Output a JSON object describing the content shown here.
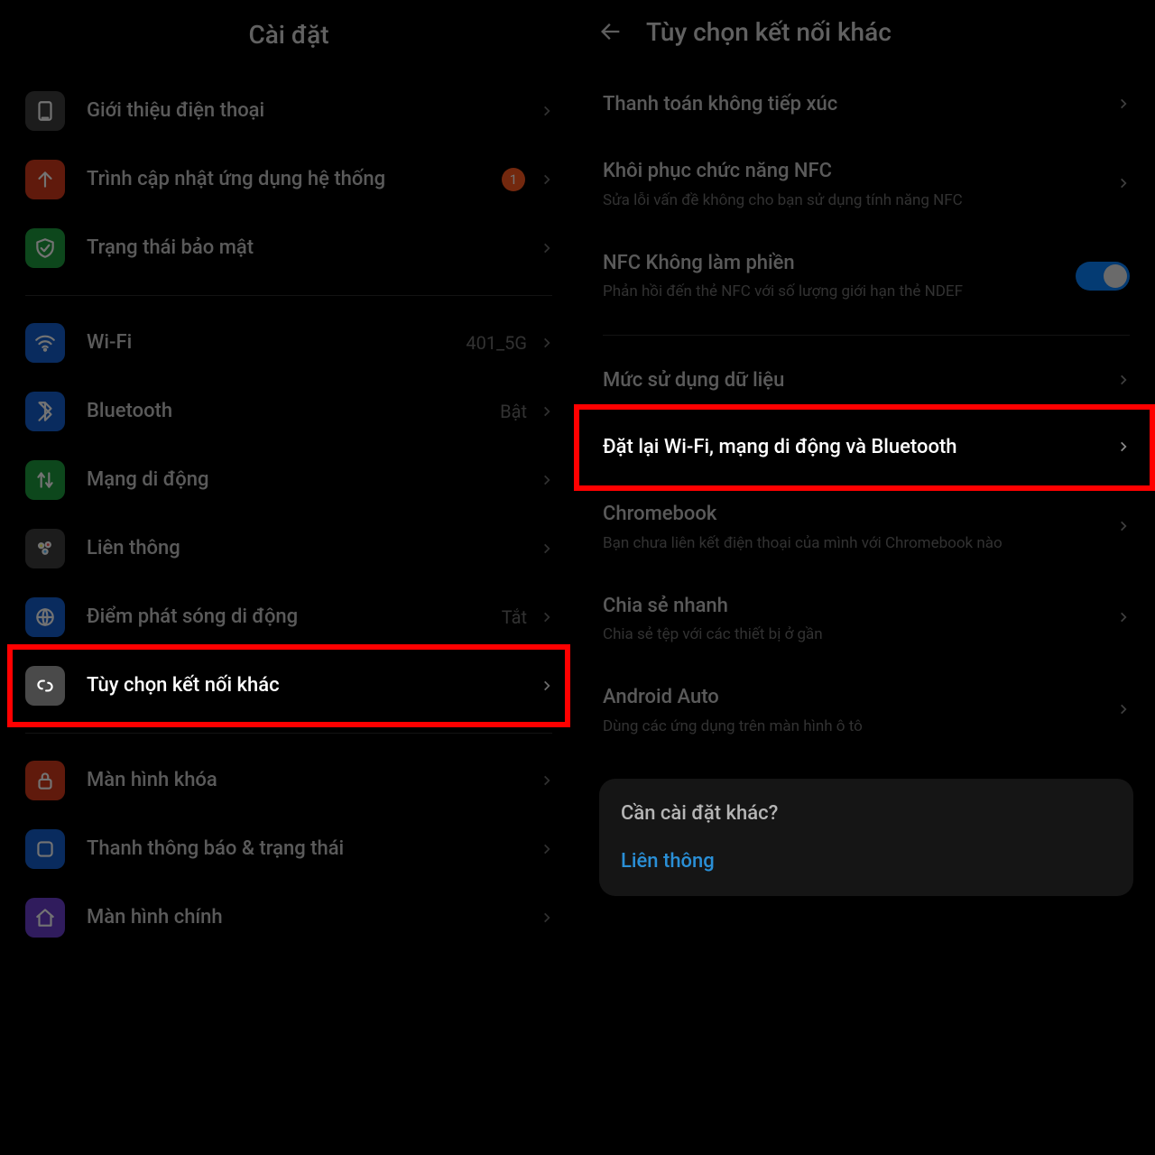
{
  "left": {
    "title": "Cài đặt",
    "items": [
      {
        "key": "about",
        "label": "Giới thiệu điện thoại",
        "icon_bg": "#3e3e3e",
        "icon": "phone"
      },
      {
        "key": "updater",
        "label": "Trình cập nhật ứng dụng hệ thống",
        "icon_bg": "#d63a1c",
        "icon": "arrow-up",
        "badge": "1"
      },
      {
        "key": "security",
        "label": "Trạng thái bảo mật",
        "icon_bg": "#1e9e3e",
        "icon": "shield"
      },
      {
        "divider": true
      },
      {
        "key": "wifi",
        "label": "Wi-Fi",
        "icon_bg": "#1660d0",
        "icon": "wifi",
        "value": "401_5G"
      },
      {
        "key": "bluetooth",
        "label": "Bluetooth",
        "icon_bg": "#1660d0",
        "icon": "bluetooth",
        "value": "Bật"
      },
      {
        "key": "mobile",
        "label": "Mạng di động",
        "icon_bg": "#1e9e3e",
        "icon": "data"
      },
      {
        "key": "interconnect",
        "label": "Liên thông",
        "icon_bg": "#3e3e3e",
        "icon": "dots"
      },
      {
        "key": "hotspot",
        "label": "Điểm phát sóng di động",
        "icon_bg": "#1660d0",
        "icon": "link",
        "value": "Tắt"
      },
      {
        "key": "other-conn",
        "label": "Tùy chọn kết nối khác",
        "icon_bg": "#4a4a4a",
        "icon": "chain",
        "highlight": true
      },
      {
        "divider": true
      },
      {
        "key": "lockscreen",
        "label": "Màn hình khóa",
        "icon_bg": "#d63a1c",
        "icon": "lock"
      },
      {
        "key": "notif",
        "label": "Thanh thông báo & trạng thái",
        "icon_bg": "#1660d0",
        "icon": "square"
      },
      {
        "key": "home",
        "label": "Màn hình chính",
        "icon_bg": "#6a3fcf",
        "icon": "home"
      }
    ]
  },
  "right": {
    "title": "Tùy chọn kết nối khác",
    "items": [
      {
        "key": "contactless",
        "title": "Thanh toán không tiếp xúc"
      },
      {
        "key": "nfc-restore",
        "title": "Khôi phục chức năng NFC",
        "sub": "Sửa lỗi vấn đề không cho bạn sử dụng tính năng NFC"
      },
      {
        "key": "nfc-dnd",
        "title": "NFC Không làm phiền",
        "sub": "Phản hồi đến thẻ NFC với số lượng giới hạn thẻ NDEF",
        "toggle": true
      },
      {
        "divider": true
      },
      {
        "key": "data-usage",
        "title": "Mức sử dụng dữ liệu"
      },
      {
        "key": "reset",
        "title": "Đặt lại Wi-Fi, mạng di động và Bluetooth",
        "highlight": true
      },
      {
        "key": "chromebook",
        "title": "Chromebook",
        "sub": "Bạn chưa liên kết điện thoại của mình với Chromebook nào"
      },
      {
        "key": "nearby",
        "title": "Chia sẻ nhanh",
        "sub": "Chia sẻ tệp với các thiết bị ở gần"
      },
      {
        "key": "auto",
        "title": "Android Auto",
        "sub": "Dùng các ứng dụng trên màn hình ô tô"
      }
    ],
    "tip": {
      "question": "Cần cài đặt khác?",
      "link": "Liên thông"
    }
  }
}
